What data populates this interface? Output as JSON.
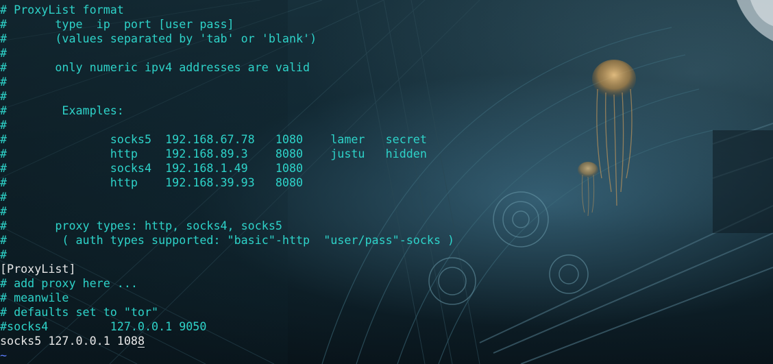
{
  "editor": {
    "lines": [
      {
        "text": "# ProxyList format",
        "style": "comment"
      },
      {
        "text": "#       type  ip  port [user pass]",
        "style": "comment"
      },
      {
        "text": "#       (values separated by 'tab' or 'blank')",
        "style": "comment"
      },
      {
        "text": "#",
        "style": "comment"
      },
      {
        "text": "#       only numeric ipv4 addresses are valid",
        "style": "comment"
      },
      {
        "text": "#",
        "style": "comment"
      },
      {
        "text": "#",
        "style": "comment"
      },
      {
        "text": "#        Examples:",
        "style": "comment"
      },
      {
        "text": "#",
        "style": "comment"
      },
      {
        "text": "#               socks5  192.168.67.78   1080    lamer   secret",
        "style": "comment"
      },
      {
        "text": "#               http    192.168.89.3    8080    justu   hidden",
        "style": "comment"
      },
      {
        "text": "#               socks4  192.168.1.49    1080",
        "style": "comment"
      },
      {
        "text": "#               http    192.168.39.93   8080",
        "style": "comment"
      },
      {
        "text": "#",
        "style": "comment"
      },
      {
        "text": "#",
        "style": "comment"
      },
      {
        "text": "#       proxy types: http, socks4, socks5",
        "style": "comment"
      },
      {
        "text": "#        ( auth types supported: \"basic\"-http  \"user/pass\"-socks )",
        "style": "comment"
      },
      {
        "text": "#",
        "style": "comment"
      },
      {
        "text": "[ProxyList]",
        "style": "plain"
      },
      {
        "text": "# add proxy here ...",
        "style": "comment"
      },
      {
        "text": "# meanwile",
        "style": "comment"
      },
      {
        "text": "# defaults set to \"tor\"",
        "style": "comment"
      },
      {
        "text": "#socks4         127.0.0.1 9050",
        "style": "comment"
      }
    ],
    "current_line_before_cursor": "socks5 127.0.0.1 108",
    "cursor_char": "8",
    "tilde": "~"
  },
  "colors": {
    "comment": "#2ed3c9",
    "plain": "#e8e8e8",
    "tilde": "#5c7cfa",
    "background": "#0b1a22"
  }
}
